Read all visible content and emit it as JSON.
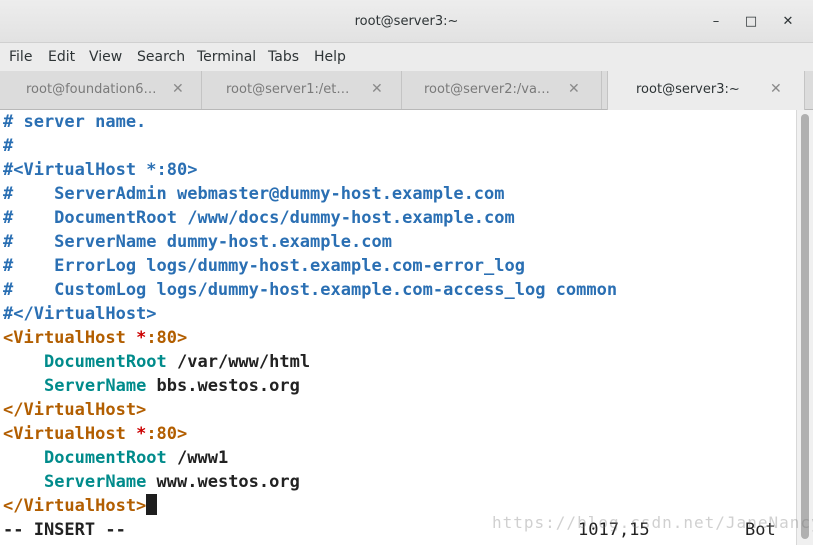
{
  "window": {
    "title": "root@server3:~",
    "minimize_glyph": "–",
    "maximize_glyph": "□",
    "close_glyph": "✕"
  },
  "menu": [
    "File",
    "Edit",
    "View",
    "Search",
    "Terminal",
    "Tabs",
    "Help"
  ],
  "tabs": [
    {
      "label": "root@foundation6…",
      "close": "✕",
      "active": false
    },
    {
      "label": "root@server1:/et…",
      "close": "✕",
      "active": false
    },
    {
      "label": "root@server2:/va…",
      "close": "✕",
      "active": false
    },
    {
      "label": "root@server3:~",
      "close": "✕",
      "active": true
    }
  ],
  "editor": {
    "lines": [
      [
        {
          "t": "# server name.",
          "c": "comment"
        }
      ],
      [
        {
          "t": "#",
          "c": "comment"
        }
      ],
      [
        {
          "t": "#<VirtualHost *:80>",
          "c": "comment"
        }
      ],
      [
        {
          "t": "#    ServerAdmin webmaster@dummy-host.example.com",
          "c": "comment"
        }
      ],
      [
        {
          "t": "#    DocumentRoot /www/docs/dummy-host.example.com",
          "c": "comment"
        }
      ],
      [
        {
          "t": "#    ServerName dummy-host.example.com",
          "c": "comment"
        }
      ],
      [
        {
          "t": "#    ErrorLog logs/dummy-host.example.com-error_log",
          "c": "comment"
        }
      ],
      [
        {
          "t": "#    CustomLog logs/dummy-host.example.com-access_log common",
          "c": "comment"
        }
      ],
      [
        {
          "t": "#</VirtualHost>",
          "c": "comment"
        }
      ],
      [
        {
          "t": "<VirtualHost ",
          "c": "tag"
        },
        {
          "t": "*",
          "c": "star"
        },
        {
          "t": ":80>",
          "c": "tag"
        }
      ],
      [
        {
          "t": "    ",
          "c": "text"
        },
        {
          "t": "DocumentRoot",
          "c": "dir"
        },
        {
          "t": " /var/www/html",
          "c": "text"
        }
      ],
      [
        {
          "t": "    ",
          "c": "text"
        },
        {
          "t": "ServerName",
          "c": "dir"
        },
        {
          "t": " bbs.westos.org",
          "c": "text"
        }
      ],
      [
        {
          "t": "</VirtualHost>",
          "c": "tag"
        }
      ],
      [
        {
          "t": "<VirtualHost ",
          "c": "tag"
        },
        {
          "t": "*",
          "c": "star"
        },
        {
          "t": ":80>",
          "c": "tag"
        }
      ],
      [
        {
          "t": "    ",
          "c": "text"
        },
        {
          "t": "DocumentRoot",
          "c": "dir"
        },
        {
          "t": " /www1",
          "c": "text"
        }
      ],
      [
        {
          "t": "    ",
          "c": "text"
        },
        {
          "t": "ServerName",
          "c": "dir"
        },
        {
          "t": " www.westos.org",
          "c": "text"
        }
      ],
      [
        {
          "t": "</VirtualHost>",
          "c": "tag"
        },
        {
          "t": "",
          "c": "cursor"
        }
      ]
    ],
    "status": {
      "mode": "-- INSERT --",
      "position": "1017,15",
      "scroll": "Bot"
    }
  },
  "watermark": "https://blog.csdn.net/JaneNancy",
  "colors": {
    "comment": "#2a6fb3",
    "tag": "#b25e00",
    "star": "#cc0000",
    "directive": "#008b8b",
    "text": "#222222"
  }
}
